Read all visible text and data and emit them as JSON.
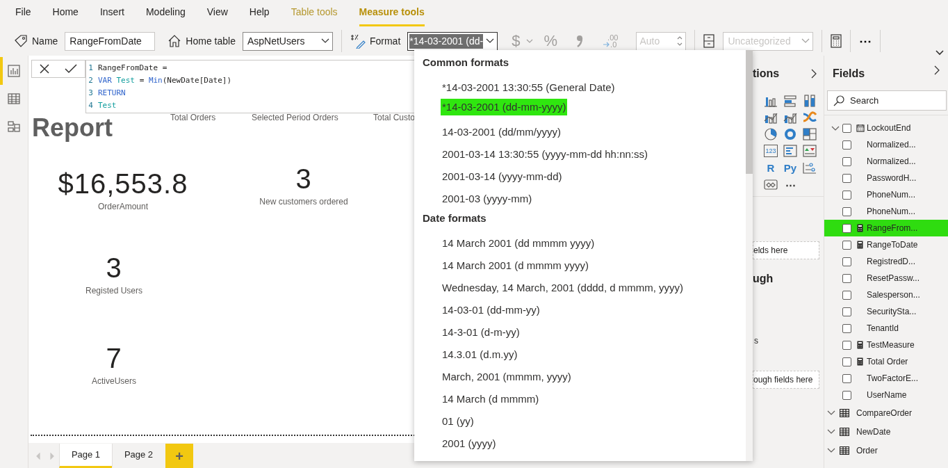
{
  "menu_tabs": [
    {
      "label": "File",
      "kind": "main",
      "selected": false
    },
    {
      "label": "Home",
      "kind": "main",
      "selected": false
    },
    {
      "label": "Insert",
      "kind": "main",
      "selected": false
    },
    {
      "label": "Modeling",
      "kind": "main",
      "selected": false
    },
    {
      "label": "View",
      "kind": "main",
      "selected": false
    },
    {
      "label": "Help",
      "kind": "main",
      "selected": false
    },
    {
      "label": "Table tools",
      "kind": "contextual",
      "selected": false
    },
    {
      "label": "Measure tools",
      "kind": "contextual",
      "selected": true
    }
  ],
  "ribbon": {
    "name_label": "Name",
    "name_value": "RangeFromDate",
    "home_table_label": "Home table",
    "home_table_value": "AspNetUsers",
    "format_label": "Format",
    "format_value": "*14-03-2001 (dd-",
    "number_tools": [
      {
        "kind": "currency",
        "label": "$",
        "disabled": true
      },
      {
        "kind": "percent",
        "label": "%",
        "disabled": true
      },
      {
        "kind": "comma",
        "disabled": true
      },
      {
        "kind": "decimals",
        "top": ".00",
        "bottom": ".0",
        "disabled": true
      }
    ],
    "decimal_places": {
      "value": "Auto",
      "disabled": true
    },
    "data_category": {
      "value": "Uncategorized",
      "disabled": true
    },
    "more": "⋯"
  },
  "rail": [
    {
      "kind": "report",
      "selected": true
    },
    {
      "kind": "data",
      "selected": false
    },
    {
      "kind": "model",
      "selected": false
    }
  ],
  "formula_bar": {
    "lines": [
      {
        "number": "1",
        "tokens": [
          {
            "kind": "plain",
            "text": "RangeFromDate ="
          }
        ]
      },
      {
        "number": "2",
        "tokens": [
          {
            "kind": "keyword",
            "text": "VAR"
          },
          {
            "kind": "variable",
            "text": "Test"
          },
          {
            "kind": "plain",
            "text": "="
          },
          {
            "kind": "function",
            "text": "Min"
          },
          {
            "kind": "plain",
            "text": "(NewDate[Date])",
            "attached": true
          }
        ]
      },
      {
        "number": "3",
        "tokens": [
          {
            "kind": "keyword",
            "text": "RETURN"
          }
        ]
      },
      {
        "number": "4",
        "tokens": [
          {
            "kind": "variable",
            "text": "Test"
          }
        ]
      }
    ]
  },
  "report": {
    "title": "Report",
    "column_headers": [
      "Total Orders",
      "Selected Period Orders",
      "Total Custo"
    ],
    "cards": [
      {
        "value": "$16,553.8",
        "label": "OrderAmount"
      },
      {
        "value": "3",
        "label": "New customers ordered"
      },
      {
        "value": "3",
        "label": "Registed Users"
      },
      {
        "value": "7",
        "label": "ActiveUsers"
      }
    ]
  },
  "page_tabs": [
    {
      "label": "Page 1",
      "selected": true
    },
    {
      "label": "Page 2",
      "selected": false
    }
  ],
  "add_page": "+",
  "format_dropdown": {
    "sections": [
      {
        "title": "Common formats",
        "items": [
          {
            "label": "*14-03-2001 13:30:55 (General Date)",
            "selected": false
          },
          {
            "label": "*14-03-2001 (dd-mm-yyyy)",
            "selected": true
          },
          {
            "label": "14-03-2001 (dd/mm/yyyy)",
            "selected": false
          },
          {
            "label": "2001-03-14 13:30:55 (yyyy-mm-dd hh:nn:ss)",
            "selected": false
          },
          {
            "label": "2001-03-14 (yyyy-mm-dd)",
            "selected": false
          },
          {
            "label": "2001-03 (yyyy-mm)",
            "selected": false
          }
        ]
      },
      {
        "title": "Date formats",
        "items": [
          {
            "label": "14 March 2001 (dd mmmm yyyy)",
            "selected": false
          },
          {
            "label": "14 March 2001 (d mmmm yyyy)",
            "selected": false
          },
          {
            "label": "Wednesday, 14 March, 2001 (dddd, d mmmm, yyyy)",
            "selected": false
          },
          {
            "label": "14-03-01 (dd-mm-yy)",
            "selected": false
          },
          {
            "label": "14-3-01 (d-m-yy)",
            "selected": false
          },
          {
            "label": "14.3.01 (d.m.yy)",
            "selected": false
          },
          {
            "label": "March, 2001 (mmmm, yyyy)",
            "selected": false
          },
          {
            "label": "14 March (d mmmm)",
            "selected": false
          },
          {
            "label": "01 (yy)",
            "selected": false
          },
          {
            "label": "2001 (yyyy)",
            "selected": false
          }
        ]
      }
    ]
  },
  "visualizations": {
    "title": "tions",
    "icons": [
      {
        "kind": "column"
      },
      {
        "kind": "hbar"
      },
      {
        "kind": "column100"
      },
      {
        "kind": "combo"
      },
      {
        "kind": "combo"
      },
      {
        "kind": "ribbon"
      },
      {
        "kind": "pie"
      },
      {
        "kind": "donut"
      },
      {
        "kind": "treemap"
      },
      {
        "kind": "card",
        "label": "123"
      },
      {
        "kind": "multirow"
      },
      {
        "kind": "kpi"
      },
      {
        "kind": "text",
        "label": "R"
      },
      {
        "kind": "text",
        "label": "Py"
      },
      {
        "kind": "influencers"
      },
      {
        "kind": "map"
      },
      {
        "kind": "more",
        "label": "⋯"
      }
    ],
    "values_drop": "elds here",
    "drillthrough_title": "ugh",
    "drill_fragment": "s",
    "drillthrough_drop": "ough fields here"
  },
  "fields": {
    "title": "Fields",
    "search": {
      "placeholder": "Search"
    },
    "columns": [
      {
        "name": "LockoutEnd",
        "kind": "date",
        "checked": false,
        "selected": false
      },
      {
        "name": "Normalized...",
        "kind": "column",
        "checked": false,
        "selected": false
      },
      {
        "name": "Normalized...",
        "kind": "column",
        "checked": false,
        "selected": false
      },
      {
        "name": "PasswordH...",
        "kind": "column",
        "checked": false,
        "selected": false
      },
      {
        "name": "PhoneNum...",
        "kind": "column",
        "checked": false,
        "selected": false
      },
      {
        "name": "PhoneNum...",
        "kind": "column",
        "checked": false,
        "selected": false
      },
      {
        "name": "RangeFrom...",
        "kind": "measure",
        "checked": false,
        "selected": true
      },
      {
        "name": "RangeToDate",
        "kind": "measure",
        "checked": false,
        "selected": false
      },
      {
        "name": "RegistredD...",
        "kind": "column",
        "checked": false,
        "selected": false
      },
      {
        "name": "ResetPassw...",
        "kind": "column",
        "checked": false,
        "selected": false
      },
      {
        "name": "Salesperson...",
        "kind": "column",
        "checked": false,
        "selected": false
      },
      {
        "name": "SecuritySta...",
        "kind": "column",
        "checked": false,
        "selected": false
      },
      {
        "name": "TenantId",
        "kind": "column",
        "checked": false,
        "selected": false
      },
      {
        "name": "TestMeasure",
        "kind": "measure",
        "checked": false,
        "selected": false
      },
      {
        "name": "Total Order",
        "kind": "measure",
        "checked": false,
        "selected": false
      },
      {
        "name": "TwoFactorE...",
        "kind": "column",
        "checked": false,
        "selected": false
      },
      {
        "name": "UserName",
        "kind": "column",
        "checked": false,
        "selected": false
      }
    ],
    "tables": [
      {
        "name": "CompareOrder"
      },
      {
        "name": "NewDate"
      },
      {
        "name": "Order"
      }
    ]
  }
}
